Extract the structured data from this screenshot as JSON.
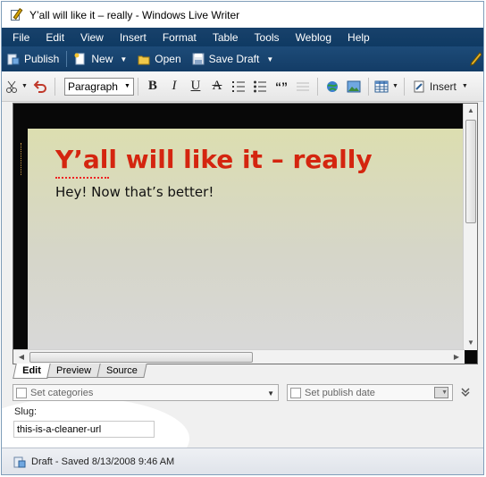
{
  "window": {
    "title": "Y’all will like it – really - Windows Live Writer"
  },
  "menu": [
    "File",
    "Edit",
    "View",
    "Insert",
    "Format",
    "Table",
    "Tools",
    "Weblog",
    "Help"
  ],
  "toolbar": {
    "publish": "Publish",
    "new": "New",
    "open": "Open",
    "save_draft": "Save Draft"
  },
  "format_toolbar": {
    "paragraph_style": "Paragraph",
    "bold": "B",
    "italic": "I",
    "underline": "U",
    "strike": "A",
    "quote": "“”",
    "insert": "Insert"
  },
  "editor": {
    "post_title": "Y’all will like it – really",
    "post_body": "Hey! Now that’s better!"
  },
  "view_tabs": [
    "Edit",
    "Preview",
    "Source"
  ],
  "properties": {
    "categories_placeholder": "Set categories",
    "publish_date_placeholder": "Set publish date",
    "slug_label": "Slug:",
    "slug_value": "this-is-a-cleaner-url"
  },
  "status": {
    "text": "Draft - Saved 8/13/2008 9:46 AM"
  },
  "colors": {
    "menubar": "#18416b",
    "post_title": "#d4250f"
  }
}
